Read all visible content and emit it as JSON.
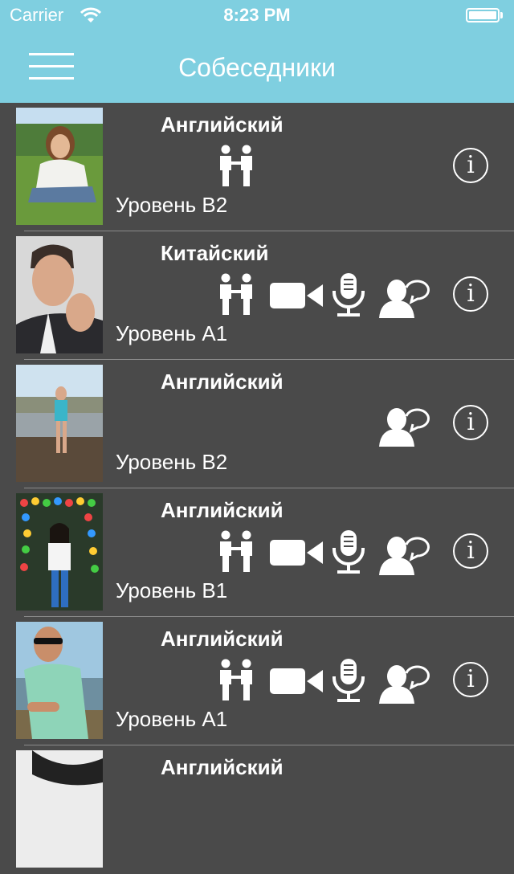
{
  "status_bar": {
    "carrier": "Carrier",
    "time": "8:23 PM",
    "battery_level": 1.0
  },
  "nav": {
    "title": "Собеседники"
  },
  "partners": [
    {
      "language": "Английский",
      "level": "Уровень B2",
      "info_label": "i",
      "photo": "woman-on-grass-photo",
      "features": {
        "meet": true,
        "video": false,
        "voice": false,
        "chat": false
      }
    },
    {
      "language": "Китайский",
      "level": "Уровень A1",
      "info_label": "i",
      "photo": "man-portrait-photo",
      "features": {
        "meet": true,
        "video": true,
        "voice": true,
        "chat": true
      }
    },
    {
      "language": "Английский",
      "level": "Уровень B2",
      "info_label": "i",
      "photo": "woman-on-bridge-photo",
      "features": {
        "meet": false,
        "video": false,
        "voice": false,
        "chat": true
      }
    },
    {
      "language": "Английский",
      "level": "Уровень B1",
      "info_label": "i",
      "photo": "woman-by-bead-curtain-photo",
      "features": {
        "meet": true,
        "video": true,
        "voice": true,
        "chat": true
      }
    },
    {
      "language": "Английский",
      "level": "Уровень A1",
      "info_label": "i",
      "photo": "man-in-sunglasses-photo",
      "features": {
        "meet": true,
        "video": true,
        "voice": true,
        "chat": true
      }
    },
    {
      "language": "Английский",
      "level": "",
      "info_label": "",
      "photo": "woman-portrait-photo",
      "features": {
        "meet": false,
        "video": false,
        "voice": false,
        "chat": false
      }
    }
  ],
  "colors": {
    "header": "#7fcfe0",
    "background": "#4a4a4a",
    "separator": "#8a8a8a",
    "text": "#ffffff"
  }
}
